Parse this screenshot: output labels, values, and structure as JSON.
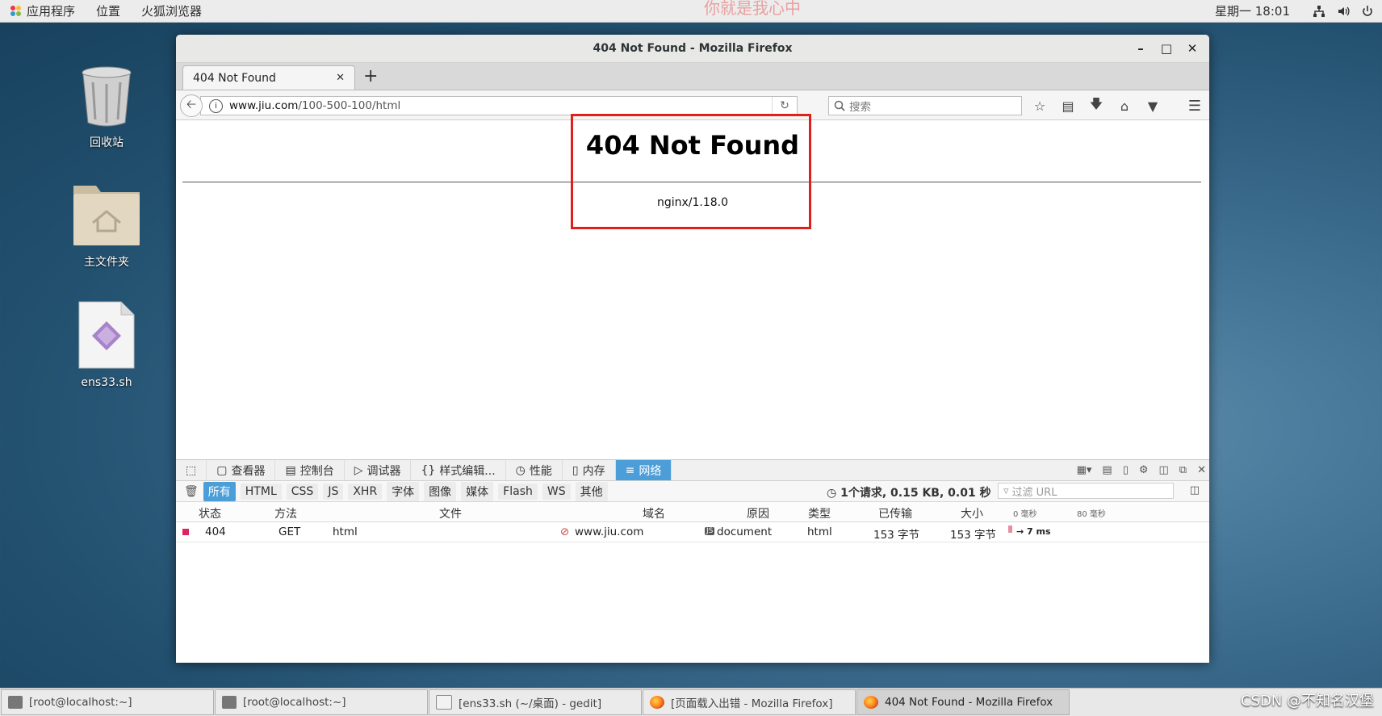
{
  "topbar": {
    "apps": "应用程序",
    "places": "位置",
    "browser": "火狐浏览器",
    "watermark": "你就是我心中",
    "clock": "星期一 18:01"
  },
  "desktop": {
    "icons": [
      {
        "label": "回收站",
        "icon": "trash-icon"
      },
      {
        "label": "主文件夹",
        "icon": "home-folder-icon"
      },
      {
        "label": "ens33.sh",
        "icon": "script-file-icon"
      }
    ]
  },
  "window": {
    "title": "404 Not Found - Mozilla Firefox"
  },
  "tab": {
    "label": "404 Not Found"
  },
  "navbar": {
    "url_host": "www.jiu.com",
    "url_path": "/100-500-100/html",
    "search_placeholder": "搜索"
  },
  "page": {
    "heading": "404 Not Found",
    "server": "nginx/1.18.0"
  },
  "devtools": {
    "tabs": [
      "查看器",
      "控制台",
      "调试器",
      "样式编辑...",
      "性能",
      "内存",
      "网络"
    ],
    "selected_tab": "网络",
    "filters": [
      "所有",
      "HTML",
      "CSS",
      "JS",
      "XHR",
      "字体",
      "图像",
      "媒体",
      "Flash",
      "WS",
      "其他"
    ],
    "summary": "1个请求, 0.15 KB, 0.01 秒",
    "url_filter_placeholder": "过滤 URL",
    "columns": {
      "status": "状态",
      "method": "方法",
      "file": "文件",
      "domain": "域名",
      "cause": "原因",
      "type": "类型",
      "transferred": "已传输",
      "size": "大小",
      "wf0": "0 毫秒",
      "wf80": "80 毫秒"
    },
    "rows": [
      {
        "status": "404",
        "method": "GET",
        "file": "html",
        "domain": "www.jiu.com",
        "cause": "document",
        "type": "html",
        "transferred": "153 字节",
        "size": "153 字节",
        "timing": "→ 7 ms"
      }
    ]
  },
  "taskbar": {
    "items": [
      {
        "label": "[root@localhost:~]"
      },
      {
        "label": "[root@localhost:~]"
      },
      {
        "label": "[ens33.sh (~/桌面) - gedit]"
      },
      {
        "label": "[页面载入出错 - Mozilla Firefox]"
      },
      {
        "label": "404 Not Found - Mozilla Firefox"
      }
    ],
    "corner": "CSDN @不知名汉堡"
  },
  "colors": {
    "highlight_box": "#e0201a",
    "devtools_accent": "#4c9ed9",
    "status_error_dot": "#e0245e"
  }
}
